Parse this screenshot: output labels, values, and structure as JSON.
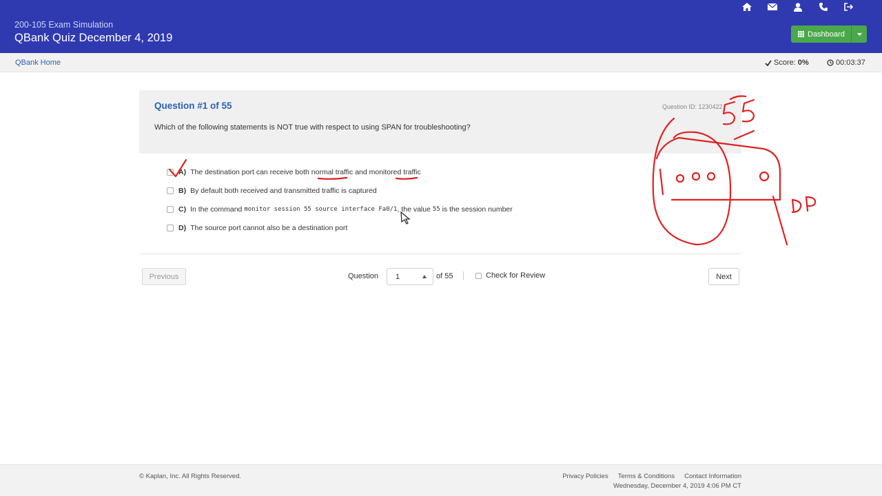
{
  "header": {
    "exam_subtitle": "200-105 Exam Simulation",
    "quiz_title": "QBank Quiz December 4, 2019",
    "dashboard_label": "Dashboard",
    "icons": [
      "home-icon",
      "envelope-icon",
      "user-icon",
      "phone-icon",
      "sign-out-icon"
    ]
  },
  "subbar": {
    "home_link": "QBank Home",
    "score_label": "Score:",
    "score_value": "0%",
    "timer": "00:03:37"
  },
  "question": {
    "number_label": "Question #1 of 55",
    "id_label": "Question ID: 1230422",
    "text": "Which of the following statements is NOT true with respect to using SPAN for troubleshooting?",
    "answers": [
      {
        "letter": "A)",
        "text": "The destination port can receive both normal traffic and monitored traffic"
      },
      {
        "letter": "B)",
        "text": "By default both received and transmitted traffic is captured"
      },
      {
        "letter": "C)",
        "text_before": "In the command",
        "code": "monitor session 55 source interface Fa0/1",
        "text_mid": ", the value",
        "code2": "55",
        "text_after": "is the session number"
      },
      {
        "letter": "D)",
        "text": "The source port cannot also be a destination port"
      }
    ]
  },
  "navigation": {
    "previous_label": "Previous",
    "next_label": "Next",
    "question_label": "Question",
    "selected_question": "1",
    "of_count": "of 55",
    "review_label": "Check for Review"
  },
  "footer": {
    "copyright": "© Kaplan, Inc. All Rights Reserved.",
    "links": [
      "Privacy Policies",
      "Terms & Conditions",
      "Contact Information"
    ],
    "datetime": "Wednesday, December 4, 2019 4:06 PM CT"
  },
  "annotations": {
    "handwritten_number": "55",
    "handwritten_label": "DP",
    "color": "#e02020"
  },
  "colors": {
    "header_bg": "#2f3ab0",
    "accent_link": "#2a62b0",
    "dashboard_btn": "#4aa84a"
  }
}
